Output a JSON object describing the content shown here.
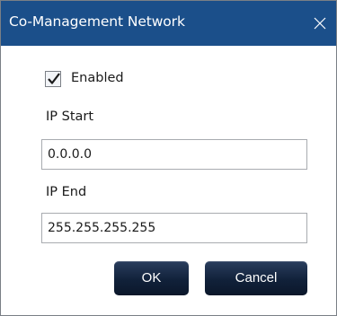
{
  "window": {
    "title": "Co-Management Network",
    "title_bar_color": "#1b4f8a",
    "close_icon": "close-icon"
  },
  "enabled": {
    "label": "Enabled",
    "checked": true
  },
  "ip_start": {
    "label": "IP Start",
    "value": "0.0.0.0"
  },
  "ip_end": {
    "label": "IP End",
    "value": "255.255.255.255"
  },
  "buttons": {
    "ok_label": "OK",
    "cancel_label": "Cancel",
    "color": "#11213a"
  }
}
